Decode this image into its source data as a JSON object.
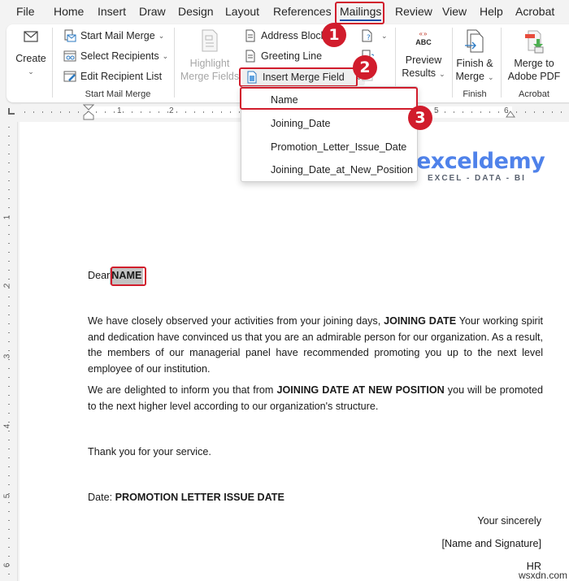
{
  "menu": {
    "tabs": [
      "File",
      "Home",
      "Insert",
      "Draw",
      "Design",
      "Layout",
      "References",
      "Mailings",
      "Review",
      "View",
      "Help",
      "Acrobat"
    ],
    "active_tab": "Mailings"
  },
  "ribbon": {
    "create": {
      "label": "Create",
      "icon": "envelope-icon"
    },
    "start_mail_merge_group": {
      "start_mail_merge": "Start Mail Merge",
      "select_recipients": "Select Recipients",
      "edit_recipient_list": "Edit Recipient List",
      "group_label": "Start Mail Merge"
    },
    "write_insert_group": {
      "highlight_line1": "Highlight",
      "highlight_line2": "Merge Fields",
      "address_block": "Address Block",
      "greeting_line": "Greeting Line",
      "insert_merge_field": "Insert Merge Field"
    },
    "preview": {
      "icon_text": "ABC",
      "line1": "Preview",
      "line2": "Results"
    },
    "finish": {
      "line1": "Finish &",
      "line2": "Merge",
      "group_label": "Finish"
    },
    "acrobat": {
      "line1": "Merge to",
      "line2": "Adobe PDF",
      "group_label": "Acrobat"
    }
  },
  "merge_field_dropdown": {
    "items": [
      "Name",
      "Joining_Date",
      "Promotion_Letter_Issue_Date",
      "Joining_Date_at_New_Position"
    ],
    "highlighted": "Name"
  },
  "callouts": [
    "1",
    "2",
    "3"
  ],
  "ruler": {
    "horizontal_numbers": [
      "1",
      "2",
      "5",
      "6"
    ],
    "vertical_numbers": [
      "1",
      "2",
      "3",
      "4",
      "5",
      "6"
    ]
  },
  "logo": {
    "main": "exceldemy",
    "sub": "EXCEL - DATA - BI"
  },
  "document": {
    "greeting": "Dear",
    "name_field": "NAME",
    "p1_before": "We have closely observed your activities from your joining days, ",
    "p1_field": "JOINING DATE",
    "p1_after": " Your working spirit and dedication have convinced us that you are an admirable person for our organization. As a result, the members of our managerial panel have recommended promoting you up to the next level employee of our institution.",
    "p2_before": "We are delighted to inform you that from ",
    "p2_field": "JOINING DATE AT NEW POSITION",
    "p2_after": " you will be promoted to the next higher level according to our organization's structure.",
    "thanks": "Thank you for your service.",
    "date_label": "Date: ",
    "date_field": "PROMOTION LETTER ISSUE DATE",
    "closing": "Your sincerely",
    "signature": "[Name and Signature]",
    "title": "HR"
  },
  "watermark": "wsxdn.com"
}
